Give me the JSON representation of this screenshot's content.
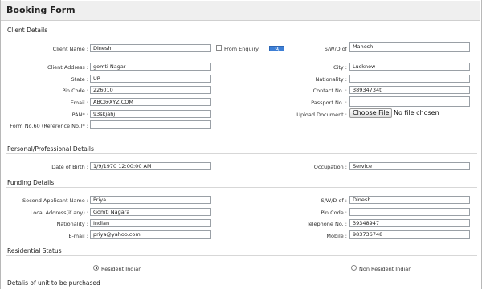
{
  "header": {
    "title": "Booking Form"
  },
  "sections": {
    "client": "Client Details",
    "personal": "Personal/Professional Details",
    "funding": "Funding Details",
    "residential": "Residential Status",
    "unit": "Detalis of unit to be purchased"
  },
  "client": {
    "client_name": {
      "label": "Client Name :",
      "value": "Dinesh"
    },
    "from_enquiry": {
      "label": "From Enquiry",
      "checked": false
    },
    "swd": {
      "label": "S/W/D of",
      "value": "Mahesh"
    },
    "client_address": {
      "label": "Client Address :",
      "value": "gomti Nagar"
    },
    "city": {
      "label": "City :",
      "value": "Lucknow"
    },
    "state": {
      "label": "State :",
      "value": "UP"
    },
    "nationality": {
      "label": "Nationality :",
      "value": ""
    },
    "pin_code": {
      "label": "Pin Code :",
      "value": "226010"
    },
    "contact_no": {
      "label": "Contact No. :",
      "value": "38934734t"
    },
    "email": {
      "label": "Email :",
      "value": "ABC@XYZ.COM"
    },
    "passport_no": {
      "label": "Passport No. :",
      "value": ""
    },
    "pan": {
      "label": "PAN* :",
      "value": "93skjahj"
    },
    "upload_document": {
      "label": "Upload Document :",
      "button": "Choose File",
      "status": "No file chosen"
    },
    "form60": {
      "label": "Form No.60 (Reference No.)* :",
      "value": ""
    }
  },
  "personal": {
    "dob": {
      "label": "Date of Birth :",
      "value": "1/9/1970 12:00:00 AM"
    },
    "occupation": {
      "label": "Occupation :",
      "value": "Service"
    }
  },
  "funding": {
    "second_applicant": {
      "label": "Second Applicant Name :",
      "value": "Priya"
    },
    "swd": {
      "label": "S/W/D of :",
      "value": "Dinesh"
    },
    "local_address": {
      "label": "Local Address(if any) :",
      "value": "Gomti Nagara"
    },
    "pin_code": {
      "label": "Pin Code :",
      "value": ""
    },
    "nationality": {
      "label": "Nationality :",
      "value": "Indian"
    },
    "telephone": {
      "label": "Telephone No. :",
      "value": "39348947"
    },
    "email": {
      "label": "E-mail :",
      "value": "priya@yahoo.com"
    },
    "mobile": {
      "label": "Mobile :",
      "value": "983736748"
    }
  },
  "residential": {
    "resident": {
      "label": "Resident Indian",
      "selected": true
    },
    "non_resident": {
      "label": "Non Resident Indian",
      "selected": false
    }
  },
  "icons": {
    "search_button": "search-icon"
  },
  "colors": {
    "search_button": "#3d7fd6"
  }
}
